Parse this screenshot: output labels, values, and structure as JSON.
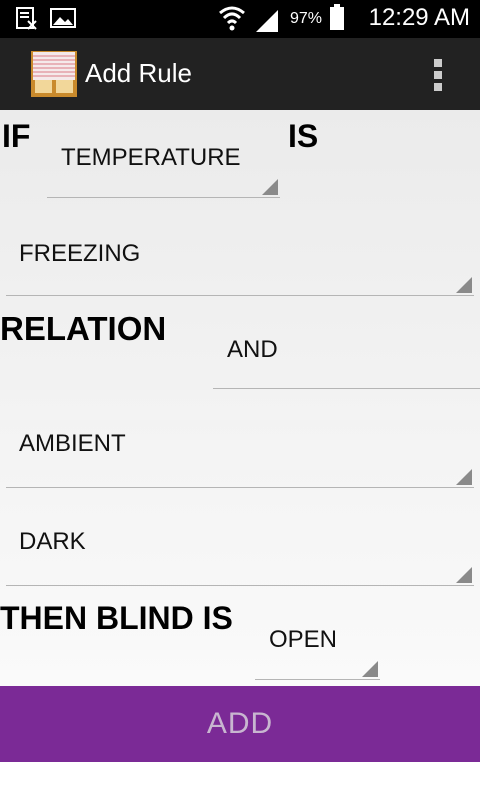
{
  "status_bar": {
    "battery_percent": "97%",
    "time": "12:29 AM",
    "icons": [
      "notification-icon",
      "image-icon",
      "wifi-icon",
      "signal-icon",
      "battery-icon"
    ]
  },
  "action_bar": {
    "title": "Add Rule",
    "app_icon": "window-blind-icon",
    "menu_icon": "overflow-menu-icon"
  },
  "form": {
    "if_label": "IF",
    "is_label": "IS",
    "sensor_value": "TEMPERATURE",
    "condition_value": "FREEZING",
    "relation_label": "RELATION",
    "relation_value": "AND",
    "second_sensor_value": "AMBIENT",
    "second_condition_value": "DARK",
    "then_label": "THEN BLIND IS",
    "action_value": "OPEN"
  },
  "buttons": {
    "add_label": "ADD"
  }
}
